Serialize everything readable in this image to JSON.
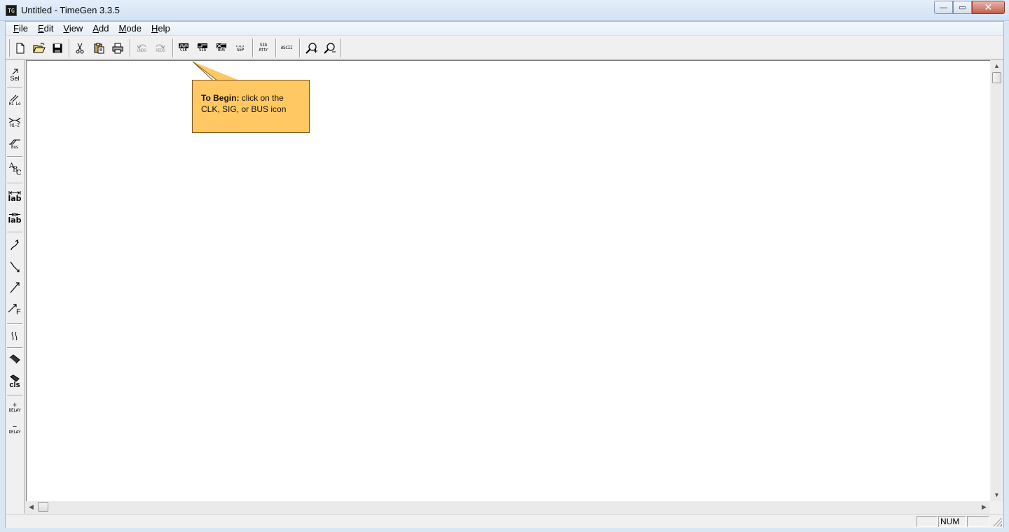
{
  "window": {
    "title": "Untitled - TimeGen 3.3.5",
    "app_icon_text": "TG",
    "minimize_glyph": "—",
    "maximize_glyph": "▭",
    "close_glyph": "✕"
  },
  "menubar": {
    "items": [
      {
        "label": "File",
        "key": "F",
        "rest": "ile"
      },
      {
        "label": "Edit",
        "key": "E",
        "rest": "dit"
      },
      {
        "label": "View",
        "key": "V",
        "rest": "iew"
      },
      {
        "label": "Add",
        "key": "A",
        "rest": "dd"
      },
      {
        "label": "Mode",
        "key": "M",
        "rest": "ode"
      },
      {
        "label": "Help",
        "key": "H",
        "rest": "elp"
      }
    ]
  },
  "toolbar": {
    "undo_label": "UNDO",
    "redo_label": "REDO",
    "clk_label": "CLK",
    "sig_label": "SIG",
    "bus_label": "BUS",
    "sep_label": "SEP",
    "sig_attr_line1": "SIG",
    "sig_attr_line2": "Attr",
    "ascii_label": "ASCII"
  },
  "left_toolbar": {
    "sel_label": "Sel",
    "hilo_label": "Hi Lo",
    "hiz_label": "Hi-Z",
    "bus_label": "Bus",
    "abc_a": "A",
    "abc_b": "B",
    "abc_c": "C",
    "lab1_label": "lab",
    "lab2_label": "lab",
    "f_label": "F",
    "cls_label": "cls",
    "delay_plus_sign": "+",
    "delay_plus_label": "DELAY",
    "delay_minus_sign": "−",
    "delay_minus_label": "DELAY"
  },
  "callout": {
    "bold_text": "To Begin:",
    "line1_rest": " click on the",
    "line2": "CLK, SIG, or BUS icon",
    "fill_color": "#ffc862"
  },
  "statusbar": {
    "num_indicator": "NUM"
  }
}
